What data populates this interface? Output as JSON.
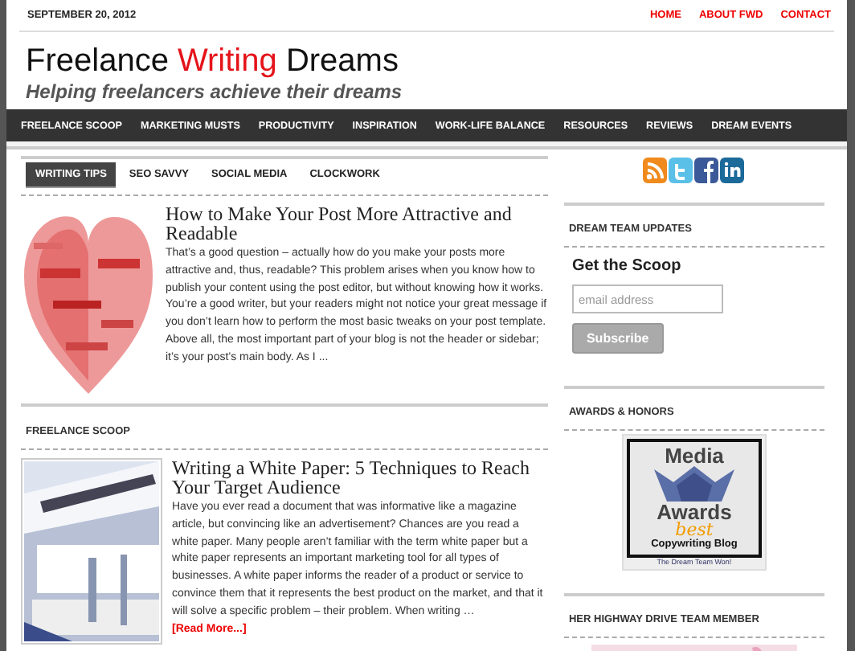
{
  "top_bar": {
    "date": "SEPTEMBER 20, 2012",
    "links": [
      "HOME",
      "ABOUT FWD",
      "CONTACT"
    ]
  },
  "site": {
    "title": {
      "before": "Freelance",
      "accent": "Writing",
      "after": "Dreams"
    },
    "tagline": "Helping freelancers achieve their dreams"
  },
  "nav": [
    "FREELANCE SCOOP",
    "MARKETING MUSTS",
    "PRODUCTIVITY",
    "INSPIRATION",
    "WORK-LIFE BALANCE",
    "RESOURCES",
    "REVIEWS",
    "DREAM EVENTS"
  ],
  "tabs": [
    {
      "label": "WRITING TIPS",
      "selected": true
    },
    {
      "label": "SEO SAVVY",
      "selected": false
    },
    {
      "label": "SOCIAL MEDIA",
      "selected": false
    },
    {
      "label": "CLOCKWORK",
      "selected": false
    }
  ],
  "tab_post": {
    "title": "How to Make Your Post More Attractive and Readable",
    "excerpt": "That’s a good question – actually how do you make your posts more attractive and, thus, readable? This problem arises when you know how to publish your content using the post editor, but without knowing how it works. You’re a good writer, but your readers might not notice your great message if you don’t learn how to perform the most basic tweaks on your post template. Above all, the most important part of your blog is not the header or sidebar; it’s your post’s main body. As I ..."
  },
  "section": {
    "heading": "FREELANCE SCOOP",
    "post": {
      "title": "Writing a White Paper: 5 Techniques to Reach Your Target Audience",
      "excerpt": "Have you ever read a document that was informative like a magazine article, but convincing like an advertisement?  Chances are you read a white paper.  Many people aren’t familiar with the term white paper but a white paper represents an important marketing tool for all types of businesses. A white paper informs the reader of a product or service to convince them that it represents the best product on the market, and that it will solve a specific problem – their problem.  When writing …",
      "read_more": "[Read More...]"
    }
  },
  "sidebar": {
    "social": [
      {
        "kind": "rss"
      },
      {
        "kind": "twitter"
      },
      {
        "kind": "facebook"
      },
      {
        "kind": "linkedin"
      }
    ],
    "widgets": [
      {
        "kind": "subscribe",
        "heading": "DREAM TEAM UPDATES",
        "title": "Get the Scoop",
        "placeholder": "email address",
        "button": "Subscribe"
      },
      {
        "kind": "badge",
        "heading": "AWARDS & HONORS",
        "badge": {
          "top": "Media",
          "middle": "Awards",
          "script": "best",
          "bottom": "Copywriting Blog",
          "caption": "The Dream Team Won!"
        }
      },
      {
        "heading": "HER HIGHWAY DRIVE TEAM MEMBER"
      }
    ]
  }
}
